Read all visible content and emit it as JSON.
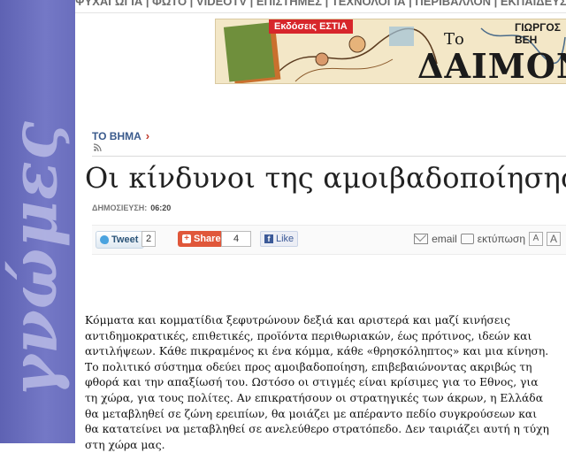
{
  "sidebar": {
    "word": "γνώμες"
  },
  "topnav": {
    "text": "ΨΥΧΑΓΩΓΙΑ | ΦΩΤΟ | VIDEOTV | ΕΠΙΣΤΗΜΕΣ | ΤΕΧΝΟΛΟΓΙΑ | ΠΕΡΙΒΑΛΛΟΝ | ΕΚΠΑΙΔΕΥΣΗ"
  },
  "banner": {
    "ribbon": "Εκδόσεις ΕΣΤΙΑ",
    "to": "Το",
    "title": "ΔΑΙΜΟΝΙΟ",
    "author": "ΓΙΩΡΓΟΣ ΒΕΗ"
  },
  "article": {
    "breadcrumb": "ΤΟ ΒΗΜΑ",
    "title": "Οι κίνδυνοι της αμοιβαδοποίησης",
    "published_label": "ΔΗΜΟΣΙΕΥΣΗ:",
    "published_time": "06:20",
    "share": {
      "tweet_label": "Tweet",
      "tweet_count": "2",
      "share_label": "Share",
      "share_count": "4",
      "like_label": "Like",
      "email_label": "email",
      "print_label": "εκτύπωση",
      "font_small": "A",
      "font_large": "A"
    },
    "body": "Κόμματα και κομματίδια ξεφυτρώνουν δεξιά και αριστερά και μαζί κινήσεις αντιδημοκρατικές, επιθετικές, προϊόντα περιθωριακών, έως πρότινος, ιδεών και αντιλήψεων. Κάθε πικραμένος κι ένα κόμμα, κάθε «θρησκόληπτος» και μια κίνηση. Το πολιτικό σύστημα οδεύει προς αμοιβαδοποίηση, επιβεβαιώνοντας ακριβώς τη φθορά και την απαξίωσή του. Ωστόσο οι στιγμές είναι κρίσιμες για το Εθνος, για τη χώρα, για τους πολίτες. Αν επικρατήσουν οι στρατηγικές των άκρων, η Ελλάδα θα μεταβληθεί σε ζώνη ερειπίων, θα μοιάζει με απέραντο πεδίο συγκρούσεων και θα κατατείνει να μεταβληθεί σε ανελεύθερο στρατόπεδο. Δεν ταιριάζει αυτή η τύχη στη χώρα μας."
  }
}
